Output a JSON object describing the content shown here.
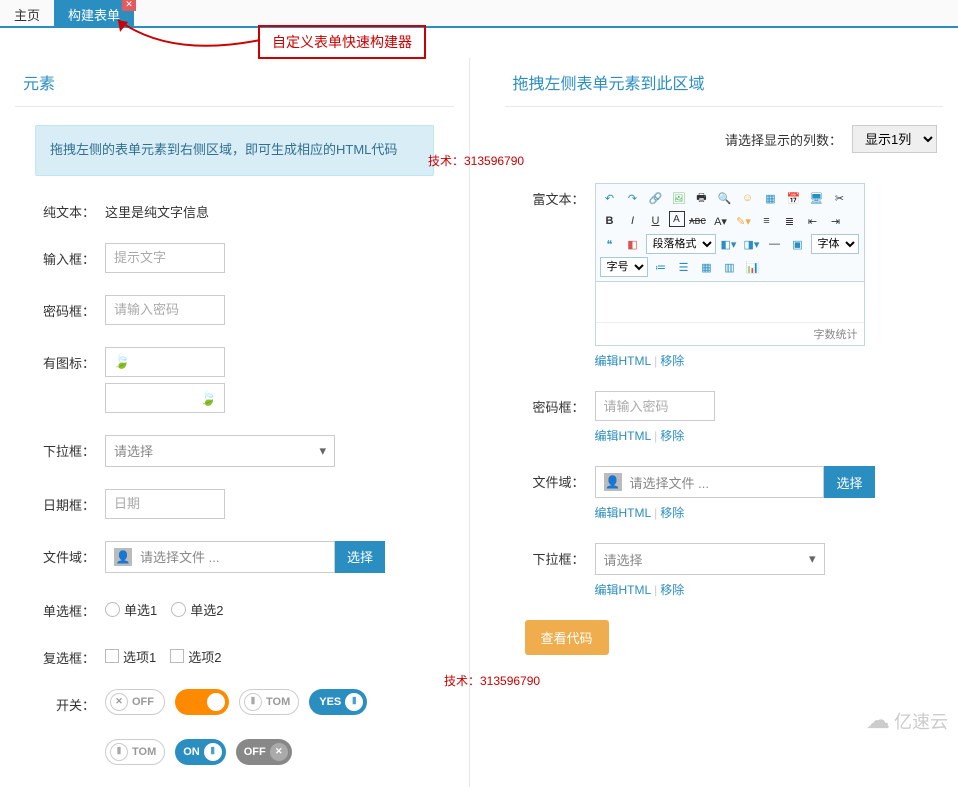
{
  "tabs": {
    "home": "主页",
    "build": "构建表单"
  },
  "annotation": "自定义表单快速构建器",
  "watermark": "技术：313596790",
  "left": {
    "title": "元素",
    "hint": "拖拽左侧的表单元素到右侧区域，即可生成相应的HTML代码",
    "labels": {
      "plaintext": "纯文本：",
      "input": "输入框：",
      "password": "密码框：",
      "withicon": "有图标：",
      "select": "下拉框：",
      "date": "日期框：",
      "file": "文件域：",
      "radio": "单选框：",
      "checkbox": "复选框：",
      "switch": "开关："
    },
    "plaintext_value": "这里是纯文字信息",
    "input_placeholder": "提示文字",
    "password_placeholder": "请输入密码",
    "select_placeholder": "请选择",
    "date_placeholder": "日期",
    "file_placeholder": "请选择文件 ...",
    "file_btn": "选择",
    "radio1": "单选1",
    "radio2": "单选2",
    "check1": "选项1",
    "check2": "选项2",
    "switches": {
      "off": "OFF",
      "tom": "TOM",
      "yes": "YES",
      "on": "ON"
    }
  },
  "right": {
    "title": "拖拽左侧表单元素到此区域",
    "col_label": "请选择显示的列数：",
    "col_value": "显示1列",
    "labels": {
      "rich": "富文本：",
      "password": "密码框：",
      "file": "文件域：",
      "select": "下拉框："
    },
    "editor": {
      "char_count": "字数统计",
      "para_format": "段落格式",
      "font_family": "字体",
      "font_size": "字号"
    },
    "password_placeholder": "请输入密码",
    "file_placeholder": "请选择文件 ...",
    "file_btn": "选择",
    "select_placeholder": "请选择",
    "actions": {
      "edit": "编辑HTML",
      "remove": "移除"
    },
    "view_code": "查看代码"
  },
  "brand": "亿速云"
}
